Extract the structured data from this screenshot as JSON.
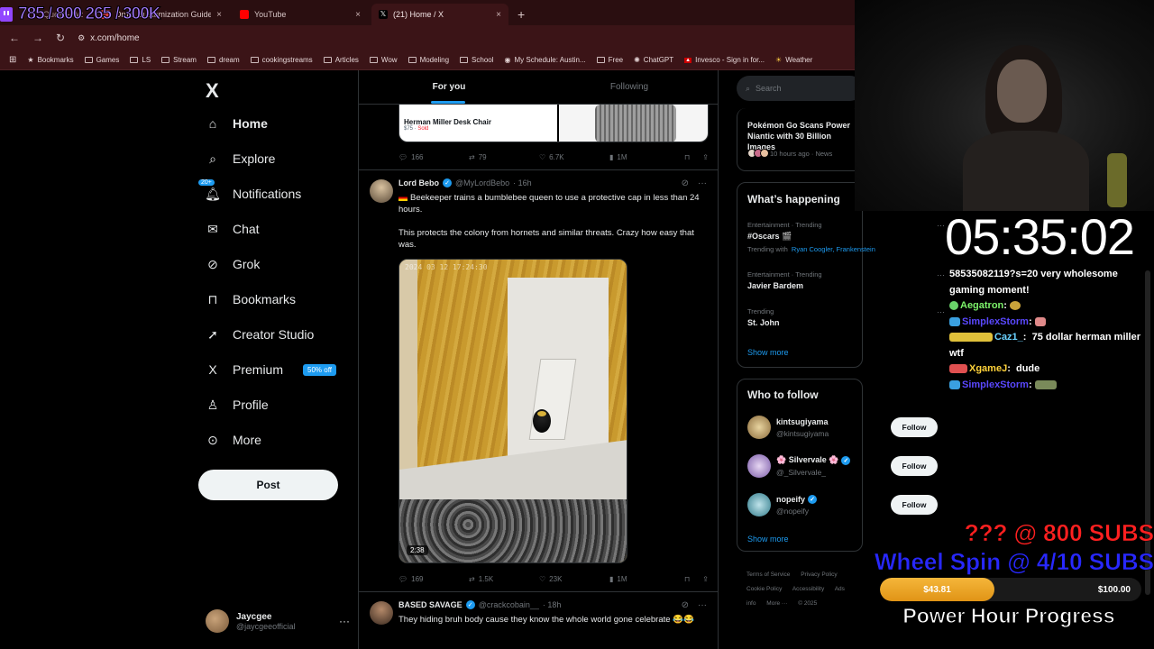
{
  "browser": {
    "tabs": [
      {
        "label": "785 / 800  265 / 300K",
        "favicon_color": "#9146ff"
      },
      {
        "label": "Quest - Wo",
        "favicon_color": "#8c5a2b"
      },
      {
        "label": "Druid Customization Guide - W",
        "favicon_color": "#d43b3b"
      },
      {
        "label": "YouTube",
        "favicon_color": "#ff0000"
      },
      {
        "label": "(21) Home / X",
        "favicon_color": "#000000"
      }
    ],
    "new_tab_glyph": "+",
    "close_glyph": "×",
    "url": "x.com/home",
    "bookmarks": [
      "Bookmarks",
      "Games",
      "LS",
      "Stream",
      "dream",
      "cookingstreams",
      "Articles",
      "Wow",
      "Modeling",
      "School",
      "My Schedule: Austin...",
      "Free",
      "ChatGPT",
      "Invesco - Sign in for...",
      "Weather"
    ]
  },
  "x": {
    "logo": "X",
    "nav": [
      {
        "label": "Home",
        "icon": "home-icon"
      },
      {
        "label": "Explore",
        "icon": "search-icon"
      },
      {
        "label": "Notifications",
        "icon": "bell-icon",
        "badge": "20+"
      },
      {
        "label": "Chat",
        "icon": "mail-icon"
      },
      {
        "label": "Grok",
        "icon": "grok-icon"
      },
      {
        "label": "Bookmarks",
        "icon": "bookmark-icon"
      },
      {
        "label": "Creator Studio",
        "icon": "rocket-icon"
      },
      {
        "label": "Premium",
        "icon": "x-icon",
        "pill": "50% off"
      },
      {
        "label": "Profile",
        "icon": "person-icon"
      },
      {
        "label": "More",
        "icon": "more-icon"
      }
    ],
    "post_label": "Post",
    "account": {
      "name": "Jaycgee",
      "handle": "@jaycgeeofficial"
    },
    "feed_tabs": [
      "For you",
      "Following"
    ],
    "prev_media": {
      "title": "Herman Miller Desk Chair",
      "price": "$75",
      "status": "Sold"
    },
    "prev_actions": [
      "166",
      "79",
      "6.7K",
      "1M"
    ],
    "tweet1": {
      "name": "Lord Bebo",
      "handle": "@MyLordBebo",
      "time": "· 16h",
      "text1": "Beekeeper trains a bumblebee queen to use a protective cap in less than 24 hours.",
      "text2": "This protects the colony from hornets and similar threats. Crazy how easy that was.",
      "video_stamp": "2024 03 12  17:24:30",
      "duration": "2:38",
      "actions": [
        "169",
        "1.5K",
        "23K",
        "1M"
      ]
    },
    "tweet2": {
      "name": "BASED SAVAGE",
      "handle": "@crackcobain__",
      "time": "· 18h",
      "text": "They hiding bruh body cause they know the whole world gone celebrate 😂😂"
    },
    "search_placeholder": "Search",
    "news": {
      "title": "Pokémon Go Scans Power Niantic with 30 Billion Images",
      "meta": "10 hours ago · News"
    },
    "whats_happening": {
      "title": "What’s happening",
      "trends": [
        {
          "category": "Entertainment · Trending",
          "name": "#Oscars 🎬",
          "with_label": "Trending with",
          "with": "Ryan Coogler, Frankenstein"
        },
        {
          "category": "Entertainment · Trending",
          "name": "Javier Bardem"
        },
        {
          "category": "Trending",
          "name": "St. John"
        }
      ],
      "show_more": "Show more"
    },
    "who_to_follow": {
      "title": "Who to follow",
      "users": [
        {
          "name": "kintsugiyama",
          "handle": "@kintsugiyama",
          "color": "#c9a86a"
        },
        {
          "name": "🌸 Silvervale 🌸",
          "handle": "@_Silvervale_",
          "color": "#b9a2d8"
        },
        {
          "name": "nopeify",
          "handle": "@nopeify",
          "color": "#6ab0c0"
        }
      ],
      "follow_label": "Follow",
      "show_more": "Show more"
    },
    "footer": [
      "Terms of Service",
      "Privacy Policy",
      "Cookie Policy",
      "Accessibility",
      "Ads info",
      "More ···",
      "© 2025"
    ]
  },
  "stream": {
    "timer": "05:35:02",
    "chat": [
      {
        "user": "",
        "msg": "58535082119?s=20 very wholesome gaming moment!"
      },
      {
        "user": "Aegatron",
        "msg": "",
        "color": "green"
      },
      {
        "user": "SimplexStorm",
        "msg": "",
        "color": "blue"
      },
      {
        "user": "Caz1_",
        "msg": "75 dollar herman miller wtf",
        "color": "cyan"
      },
      {
        "user": "XgameJ",
        "msg": "dude",
        "color": "yellow"
      },
      {
        "user": "SimplexStorm",
        "msg": "",
        "color": "blue"
      }
    ],
    "sub_goal1": "??? @ 800 SUBS",
    "sub_goal2": "Wheel Spin @ 4/10 SUBS",
    "progress": {
      "current": "$43.81",
      "goal": "$100.00",
      "fraction": 0.4381
    },
    "progress_title": "Power Hour Progress"
  }
}
